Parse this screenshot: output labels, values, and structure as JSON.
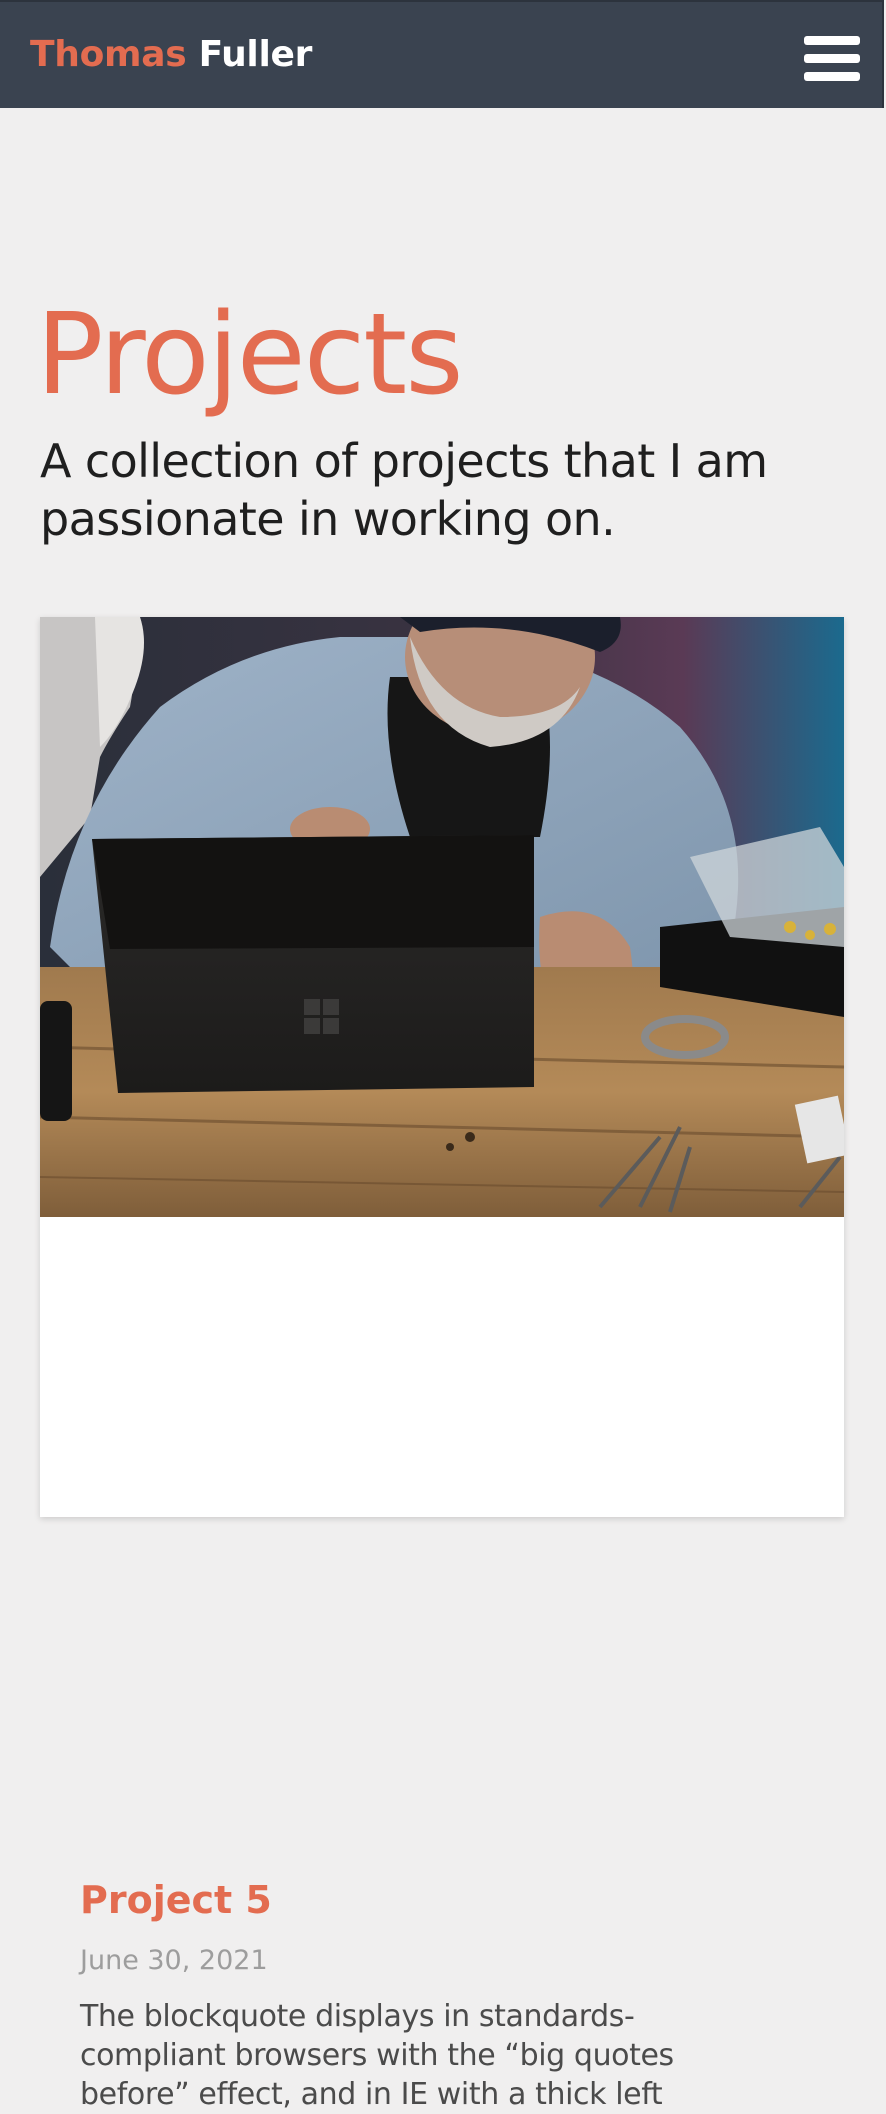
{
  "header": {
    "brand_first": "Thomas",
    "brand_last": "Fuller",
    "menu_icon": "hamburger-menu-icon"
  },
  "intro": {
    "title": "Projects",
    "subtitle": "A collection of projects that I am passionate in working on."
  },
  "projects": [
    {
      "image": "photo of a man working on a black tablet computer at a wooden workbench",
      "title": "Project 5",
      "date": "June 30, 2021",
      "excerpt": "The blockquote displays in standards-compliant browsers with the “big quotes before” effect, and in IE with a thick left"
    }
  ],
  "colors": {
    "accent": "#e36c50",
    "header_bg": "#3a4350",
    "page_bg": "#f0efef",
    "text": "#1f1f1f",
    "muted": "#9d9d9d"
  }
}
